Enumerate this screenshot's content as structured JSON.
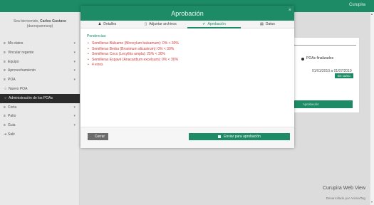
{
  "header": {
    "brand": "Curupira"
  },
  "sidebar": {
    "welcome_prefix": "Sea bienvenido,",
    "user_name": "Carlos Gustavo",
    "username": "(dueropamnsop)",
    "items": [
      {
        "icon": "≡",
        "label": "Mis datos",
        "chevron": "▾"
      },
      {
        "icon": "≡",
        "label": "Vincular regente",
        "chevron": "▾"
      },
      {
        "icon": "≡",
        "label": "Equipo",
        "chevron": "▾"
      },
      {
        "icon": "≡",
        "label": "Aprovechamiento",
        "chevron": "▾"
      },
      {
        "icon": "≡",
        "label": "POA",
        "chevron": "▾"
      },
      {
        "icon": "○",
        "label": "Nuevo POA",
        "chevron": ""
      },
      {
        "icon": "○",
        "label": "Administración de los POAs",
        "chevron": ""
      },
      {
        "icon": "≡",
        "label": "Corta",
        "chevron": "▾"
      },
      {
        "icon": "≡",
        "label": "Patio",
        "chevron": "▾"
      },
      {
        "icon": "≡",
        "label": "Guia",
        "chevron": "▾"
      },
      {
        "icon": "⇥",
        "label": "Salir",
        "chevron": ""
      }
    ]
  },
  "background": {
    "poas_label": "POAs finalizados",
    "date_range": "01/01/2010 a 01/07/2010",
    "status_badge": "En curso",
    "button_label": "Aprobación",
    "footer_title": "Curupira Web View",
    "footer_sub": "Desarrollado por AnimalTag"
  },
  "modal": {
    "title": "Aprobación",
    "close": "×",
    "tabs": [
      {
        "icon": "♟",
        "label": "Detalles"
      },
      {
        "icon": "▯",
        "label": "Adjuntar archivos"
      },
      {
        "icon": "✔",
        "label": "Aprobación"
      },
      {
        "icon": "▤",
        "label": "Datos"
      }
    ],
    "pendencias_label": "Pendencias:",
    "pendencias": [
      "Semilleras Bálsamo (Miroxylum balsamum): 0% < 30%",
      "Semilleras Berba (Brosimum alicastrum): 0% < 30%",
      "Semilleras Coco (Lecythis ampla): 25% < 30%",
      "Semilleras Espavé (Anacardium excelsum): 0% < 30%",
      "4 erros"
    ],
    "close_button": "Cerrar",
    "send_button": "Enviar para aprobación"
  },
  "colors": {
    "accent": "#1d8b66",
    "error": "#d23a3a",
    "dark": "#2b2b2b"
  }
}
